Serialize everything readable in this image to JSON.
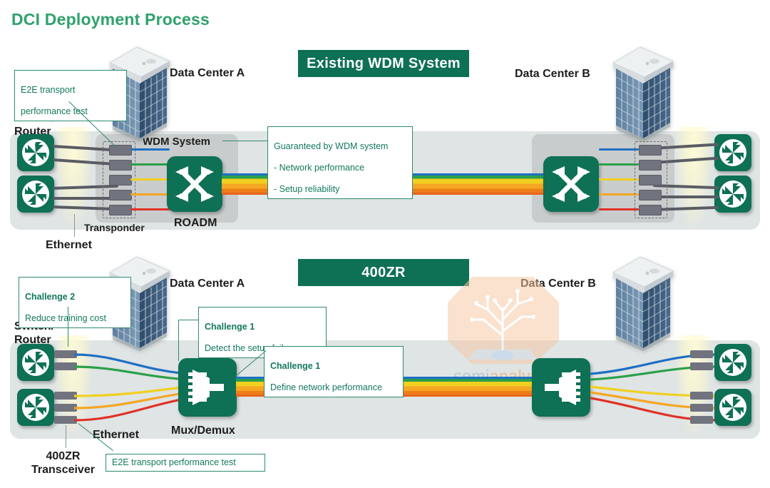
{
  "page": {
    "title": "DCI Deployment Process",
    "title_color": "#2fa26c"
  },
  "theme": {
    "brand_green": "#0e7055",
    "callout_border": "#2e8b6f",
    "callout_text": "#12795c",
    "panel_bg": "#dfe4e4",
    "subpanel_bg": "#c9cccc",
    "module_gray": "#71737f",
    "ethernet_gray": "#5a5c63"
  },
  "sections": [
    {
      "id": "existing-wdm",
      "banner": "Existing WDM System",
      "data_center_left": "Data Center A",
      "data_center_right": "Data Center B",
      "switch_router_label": "Switch/\nRouter",
      "wdm_system_label": "WDM System",
      "transponder_label": "Transponder",
      "roadm_label": "ROADM",
      "ethernet_label": "Ethernet"
    },
    {
      "id": "four-hundred-zr",
      "banner": "400ZR",
      "data_center_left": "Data Center A",
      "data_center_right": "Data Center B",
      "switch_router_label": "Switch/\nRouter",
      "mux_demux_label": "Mux/Demux",
      "ethernet_label": "Ethernet",
      "transceiver_label": "400ZR\nTransceiver"
    }
  ],
  "callouts": {
    "e2e_top": {
      "line1": "E2E transport",
      "line2": "performance test"
    },
    "guaranteed": {
      "title": "Guaranteed by WDM system",
      "bullet1": "- Network performance",
      "bullet2": "- Setup reliability"
    },
    "challenge2": {
      "title": "Challenge 2",
      "body": "Reduce training cost"
    },
    "challenge1_detect": {
      "title": "Challenge 1",
      "body": "Detect the setup failure"
    },
    "challenge1_define": {
      "title": "Challenge 1",
      "body": "Define network performance"
    },
    "e2e_bottom": {
      "text": "E2E transport performance test"
    }
  },
  "fibers": {
    "wavelength_colors": [
      "#1f6fc4",
      "#2aa04a",
      "#f0d020",
      "#f5a623",
      "#e03127"
    ],
    "trunk_description": "multiplexed rainbow trunk"
  },
  "watermark": {
    "brand_left": "semi",
    "brand_right": "analysis"
  }
}
